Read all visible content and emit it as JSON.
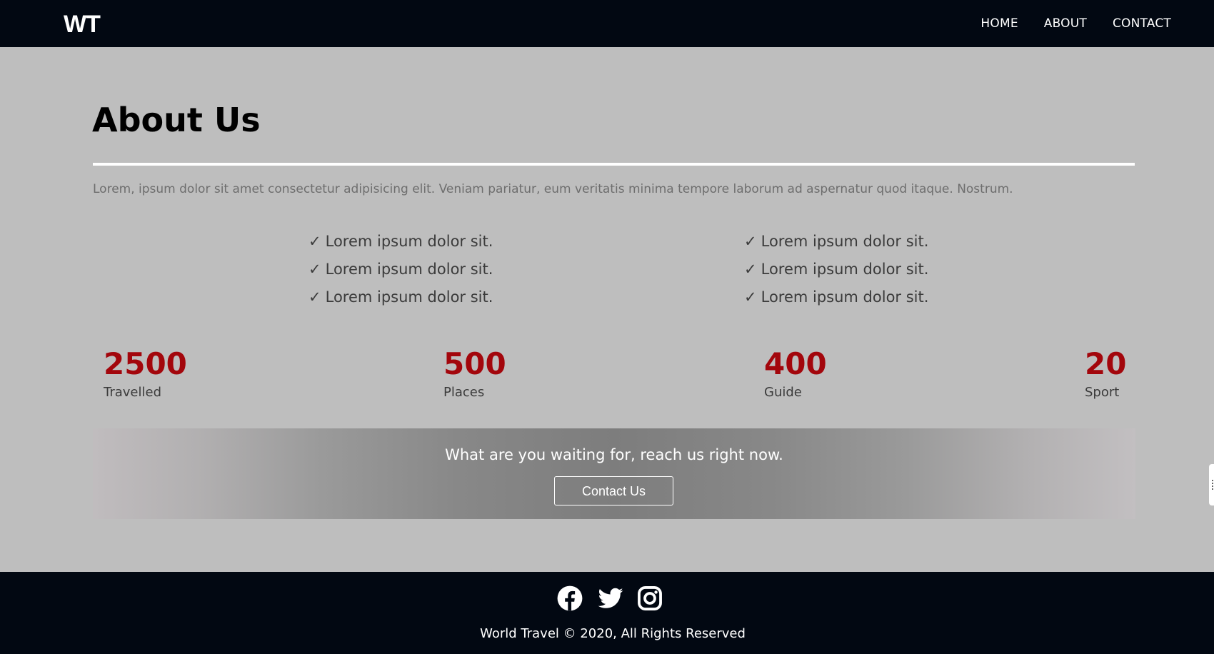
{
  "header": {
    "logo": "WT",
    "nav": [
      {
        "label": "HOME"
      },
      {
        "label": "ABOUT"
      },
      {
        "label": "CONTACT"
      }
    ]
  },
  "about": {
    "title": "About Us",
    "intro": "Lorem, ipsum dolor sit amet consectetur adipisicing elit. Veniam pariatur, eum veritatis minima tempore laborum ad aspernatur quod itaque. Nostrum.",
    "check_mark": "✓",
    "list_left": [
      "Lorem ipsum dolor sit.",
      "Lorem ipsum dolor sit.",
      "Lorem ipsum dolor sit."
    ],
    "list_right": [
      "Lorem ipsum dolor sit.",
      "Lorem ipsum dolor sit.",
      "Lorem ipsum dolor sit."
    ]
  },
  "stats": [
    {
      "value": "2500",
      "label": "Travelled"
    },
    {
      "value": "500",
      "label": "Places"
    },
    {
      "value": "400",
      "label": "Guide"
    },
    {
      "value": "20",
      "label": "Sport"
    }
  ],
  "cta": {
    "text": "What are you waiting for, reach us right now.",
    "button_label": "Contact Us"
  },
  "footer": {
    "socials": [
      {
        "icon": "facebook-icon"
      },
      {
        "icon": "twitter-icon"
      },
      {
        "icon": "instagram-icon"
      }
    ],
    "copyright": "World Travel © 2020, All Rights Reserved"
  },
  "colors": {
    "header_bg": "#020812",
    "page_bg": "#bebebe",
    "stat_number": "#a3060c",
    "text_dark": "#3b3b3b",
    "text_muted": "#6e6e6e"
  }
}
